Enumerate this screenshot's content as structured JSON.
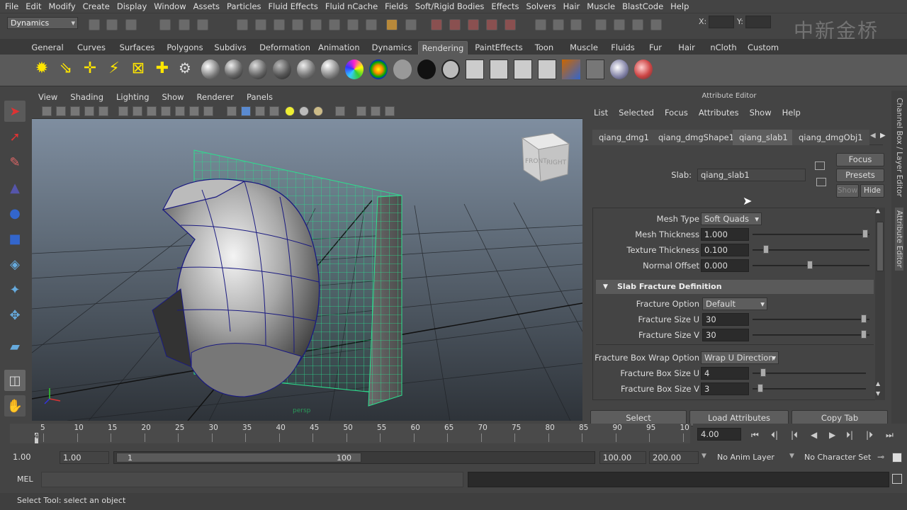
{
  "menubar": [
    "File",
    "Edit",
    "Modify",
    "Create",
    "Display",
    "Window",
    "Assets",
    "Particles",
    "Fluid Effects",
    "Fluid nCache",
    "Fields",
    "Soft/Rigid Bodies",
    "Effects",
    "Solvers",
    "Hair",
    "Muscle",
    "BlastCode",
    "Help"
  ],
  "status": {
    "mode": "Dynamics",
    "x_label": "X:",
    "y_label": "Y:",
    "watermark": "中新金桥"
  },
  "shelf_tabs": [
    "General",
    "Curves",
    "Surfaces",
    "Polygons",
    "Subdivs",
    "Deformation",
    "Animation",
    "Dynamics",
    "Rendering",
    "PaintEffects",
    "Toon",
    "Muscle",
    "Fluids",
    "Fur",
    "Hair",
    "nCloth",
    "Custom"
  ],
  "shelf_active": "Rendering",
  "viewport": {
    "menu": [
      "View",
      "Shading",
      "Lighting",
      "Show",
      "Renderer",
      "Panels"
    ],
    "camera_label": "persp",
    "viewcube": {
      "front": "FRONT",
      "right": "RIGHT"
    }
  },
  "attribute_editor": {
    "title": "Attribute Editor",
    "menu": [
      "List",
      "Selected",
      "Focus",
      "Attributes",
      "Show",
      "Help"
    ],
    "tabs": [
      "qiang_dmg1",
      "qiang_dmgShape1",
      "qiang_slab1",
      "qiang_dmgObj1"
    ],
    "active_tab": "qiang_slab1",
    "buttons": {
      "focus": "Focus",
      "presets": "Presets",
      "show": "Show",
      "hide": "Hide"
    },
    "slab_label": "Slab:",
    "slab_value": "qiang_slab1",
    "attrs": {
      "mesh_type": {
        "label": "Mesh Type",
        "value": "Soft Quads"
      },
      "mesh_thickness": {
        "label": "Mesh Thickness",
        "value": "1.000"
      },
      "texture_thickness": {
        "label": "Texture Thickness",
        "value": "0.100"
      },
      "normal_offset": {
        "label": "Normal Offset",
        "value": "0.000"
      },
      "section": "Slab Fracture Definition",
      "fracture_option": {
        "label": "Fracture Option",
        "value": "Default"
      },
      "fracture_size_u": {
        "label": "Fracture Size U",
        "value": "30"
      },
      "fracture_size_v": {
        "label": "Fracture Size V",
        "value": "30"
      },
      "wrap_option": {
        "label": "Fracture Box Wrap Option",
        "value": "Wrap U Direction"
      },
      "box_size_u": {
        "label": "Fracture Box Size U",
        "value": "4"
      },
      "box_size_v": {
        "label": "Fracture Box Size V",
        "value": "3"
      }
    },
    "bottom_buttons": {
      "select": "Select",
      "load": "Load Attributes",
      "copy": "Copy Tab"
    }
  },
  "side_tabs": {
    "channel_box": "Channel Box / Layer Editor",
    "attribute_editor": "Attribute Editor"
  },
  "timeline": {
    "ticks": [
      "5",
      "10",
      "15",
      "20",
      "25",
      "30",
      "35",
      "40",
      "45",
      "50",
      "55",
      "60",
      "65",
      "70",
      "75",
      "80",
      "85",
      "90",
      "95",
      "10"
    ],
    "current_frame_marker": "4",
    "current_time": "4.00"
  },
  "range": {
    "start_time": "1.00",
    "playback_start": "1.00",
    "slider_start": "1",
    "slider_end": "100",
    "playback_end": "100.00",
    "end_time": "200.00",
    "anim_layer": "No Anim Layer",
    "char_set": "No Character Set"
  },
  "command": {
    "label": "MEL"
  },
  "help_line": "Select Tool: select an object"
}
